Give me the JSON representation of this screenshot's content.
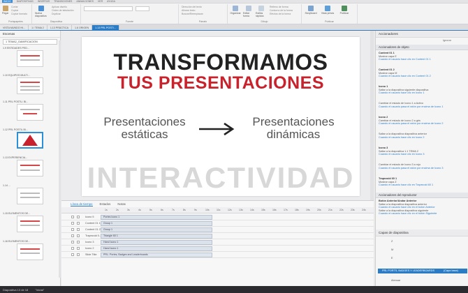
{
  "menubar": [
    "INICIO",
    "DIAPOSITIVAS",
    "INSERTAR",
    "TRANSICIONES",
    "ANIMACIONES",
    "VER",
    "AYUDA"
  ],
  "ribbon": {
    "groups": [
      "Portapapeles",
      "Diapositiva",
      "Fuente",
      "Párrafo",
      "Dibujo",
      "Publicar"
    ],
    "buttons": {
      "paste": "Pegar",
      "new_slide": "Nueva diapositiva",
      "organize": "Organizar",
      "edit_shape": "Editar forma",
      "quick_styles": "Estilos rápidos",
      "preview": "Vista previa",
      "publish": "Publicar",
      "storyboard": "Storyboard"
    },
    "small": [
      "Cortar",
      "Copiar",
      "Copiar formato",
      "Aplicar diseño",
      "Orden de tabulación",
      "Duplicar",
      "Relleno de forma",
      "Contorno de la forma",
      "Efectos de la forma",
      "Buscar/Reemplazar",
      "Dirección del texto",
      "Alinear texto"
    ]
  },
  "tabs": [
    "VISTA MUNDO HI...",
    "1 / TEMA 2",
    "1.13 PRÁCTICA",
    "1.6 ORIGEN",
    "1.13 PRL POSTI..."
  ],
  "leftpanel": {
    "title": "Escenas",
    "scene": "1 TEMA2_GAMIFICACION",
    "slides": [
      "1.9 ENTIDADES PED...",
      "1.10 EQUIPOS MULTI...",
      "1.11 PRL POSTU. BI...",
      "1.12 PRL POSTIL BI...",
      "1.13 EXPERIENCIA...",
      "1.14 ...",
      "1.15 ELEMENTOS DE...",
      "1.16 ELEMENTOS DE..."
    ]
  },
  "slide": {
    "title1": "TRANSFORMAMOS",
    "title2": "TUS PRESENTACIONES",
    "left_line1": "Presentaciones",
    "left_line2": "estáticas",
    "right_line1": "Presentaciones",
    "right_line2": "dinámicas",
    "bigword": "INTERACTIVIDAD"
  },
  "timeline": {
    "tabs": [
      "Línea de tiempo",
      "Estados",
      "Notas"
    ],
    "ticks": [
      "1s",
      "2s",
      "3s",
      "4s",
      "5s",
      "6s",
      "7s",
      "8s",
      "9s",
      "10s",
      "11s",
      "12s",
      "13s",
      "14s",
      "15s",
      "16s",
      "17s",
      "18s",
      "19s",
      "20s",
      "21s",
      "22s",
      "23s",
      "24s"
    ],
    "rows": [
      {
        "name": "Icono 5",
        "bar": "Portes Icono 1"
      },
      {
        "name": "Content 01 1",
        "bar": "Group 1"
      },
      {
        "name": "Content 01 2",
        "bar": "Group 1"
      },
      {
        "name": "Trapezoid 0...",
        "bar": "Triangle 60 1"
      },
      {
        "name": "Icono 3",
        "bar": "Hand Icono 1"
      },
      {
        "name": "Icono 2",
        "bar": "Hand Icono 1"
      },
      {
        "name": "Slide Title",
        "bar": "PRL: Portes, Badges and Leaderboards"
      }
    ]
  },
  "rightpanel": {
    "title": "Accionadores",
    "ignore": "Ignorar",
    "obj_header": "Accionadores de objeto",
    "triggers": [
      {
        "h": "Content 01 1",
        "a": "Mostrar capa E",
        "b": "Cuando el usuario hace clic en Content 01 1"
      },
      {
        "h": "Content 01 2",
        "a": "Mostrar capa M",
        "b": "Cuando el usuario hace clic en Content 01 2"
      },
      {
        "h": "Icono 1",
        "a": "Saltar a la diapositiva siguiente diapositiva",
        "b": "Cuando el usuario hace clic en Icono 1"
      },
      {
        "h": "",
        "a": "Cambiar el estado de Icono 1 a Activo",
        "b": "Cuando el usuario pasa el ratón por encima de Icono 1"
      },
      {
        "h": "Icono 2",
        "a": "Cambiar el estado de Icono 2 a gris",
        "b": "Cuando el usuario pasa el ratón por encima de Icono 2"
      },
      {
        "h": "",
        "a": "Saltar a la diapositiva diapositiva anterior",
        "b": "Cuando el usuario hace clic en Icono 2"
      },
      {
        "h": "Icono 3",
        "a": "Saltar a la diapositiva 1.1 TEMA 2",
        "b": "Cuando el usuario hace clic en Icono 3"
      },
      {
        "h": "",
        "a": "Cambiar el estado de Icono 3 a rojo",
        "b": "Cuando el usuario pasa el ratón por encima de Icono 3"
      },
      {
        "h": "Trapezoid 60 1",
        "a": "Mostrar capa Z",
        "b": "Cuando el usuario hace clic en Trapezoid 60 1"
      }
    ],
    "player_header": "Accionadores del reproductor",
    "player_sub": "Botón Anterior/Andar Anterior",
    "player_triggers": [
      {
        "a": "Saltar a la diapositiva diapositiva anterior",
        "b": "Cuando el usuario hace clic en el botón Anterior"
      },
      {
        "a": "Saltar a la diapositiva diapositiva siguiente",
        "b": "Cuando el usuario hace clic en el botón Siguiente"
      }
    ],
    "layers_title": "Capas de diapositiva",
    "layers": [
      "Z",
      "M",
      "E"
    ],
    "layer_selected": "PRL PORTS, BADGES Y LEADERBOARDS",
    "layer_selected_extra": "(Capa base)",
    "layer_bottom": "Atenuar"
  },
  "status": [
    "Diapositiva 13 de 18",
    "\"Inicial\""
  ]
}
